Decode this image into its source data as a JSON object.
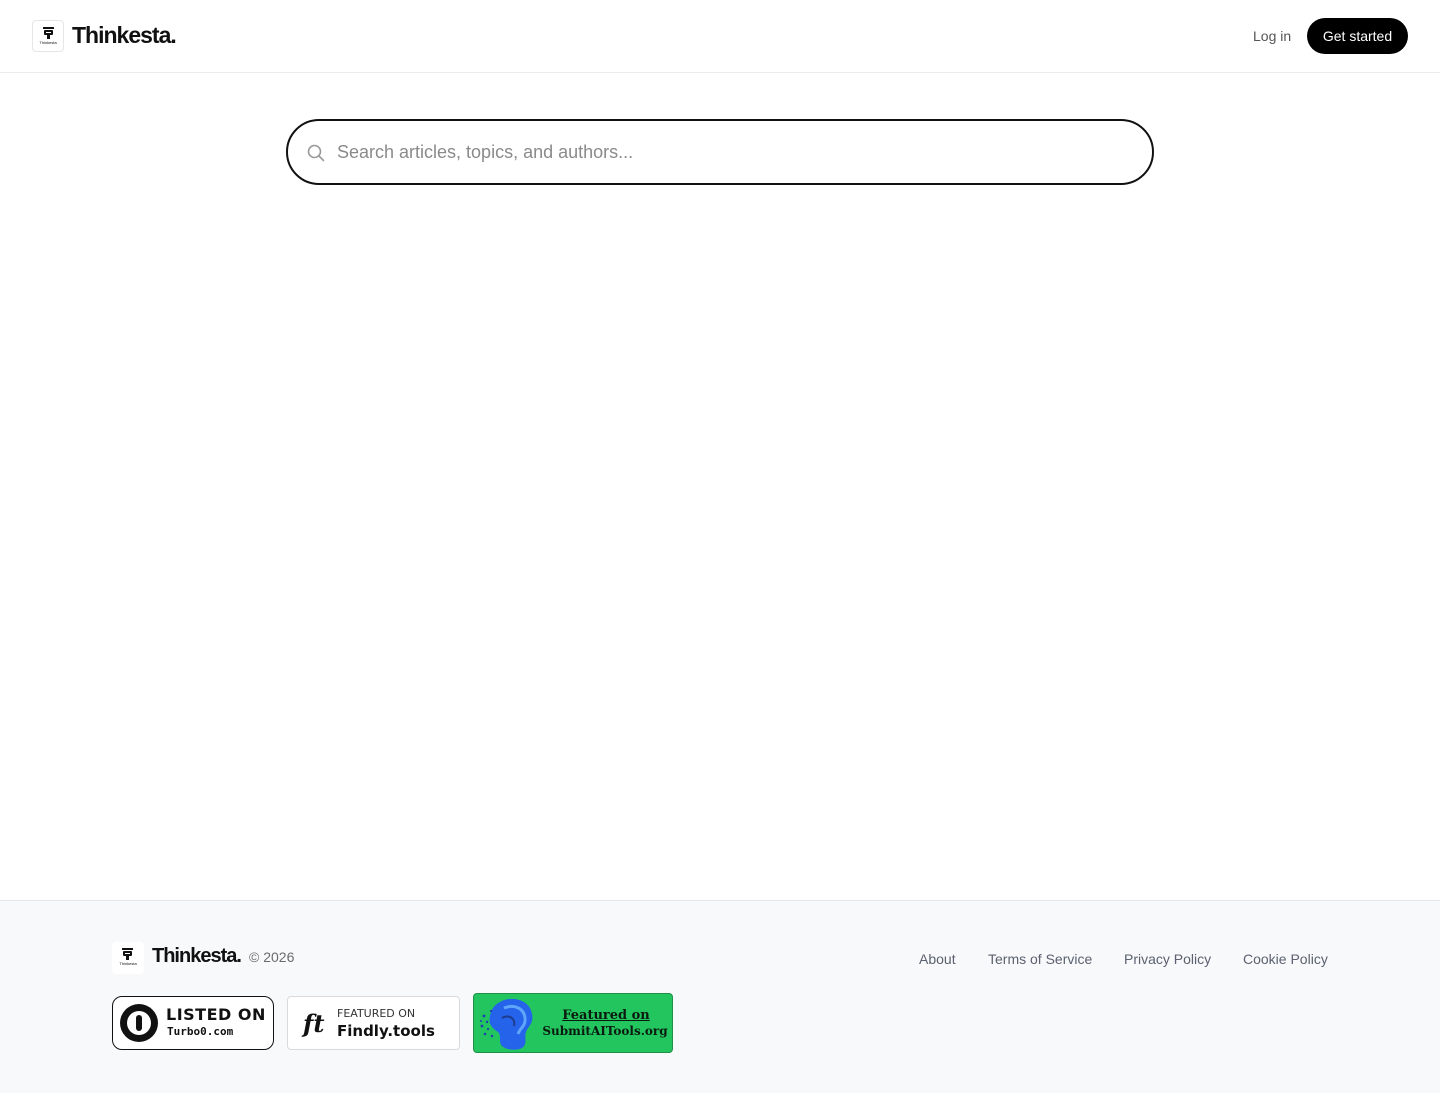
{
  "header": {
    "logo_tiny_text": "Thinkesta",
    "brand": "Thinkesta.",
    "login_label": "Log in",
    "cta_label": "Get started"
  },
  "search": {
    "placeholder": "Search articles, topics, and authors...",
    "value": ""
  },
  "footer": {
    "logo_tiny_text": "Thinkesta",
    "brand": "Thinkesta.",
    "copyright": "© 2026",
    "links": [
      "About",
      "Terms of Service",
      "Privacy Policy",
      "Cookie Policy"
    ],
    "badges": [
      {
        "line1": "LISTED ON",
        "line2": "Turbo0.com"
      },
      {
        "logo": "ft",
        "line1": "FEATURED ON",
        "line2": "Findly.tools"
      },
      {
        "line1": "Featured on",
        "line2": "SubmitAITools.org"
      }
    ]
  },
  "colors": {
    "accent": "#000000",
    "footer_bg": "#f8f9fb",
    "submitai_green": "#22c55e"
  }
}
